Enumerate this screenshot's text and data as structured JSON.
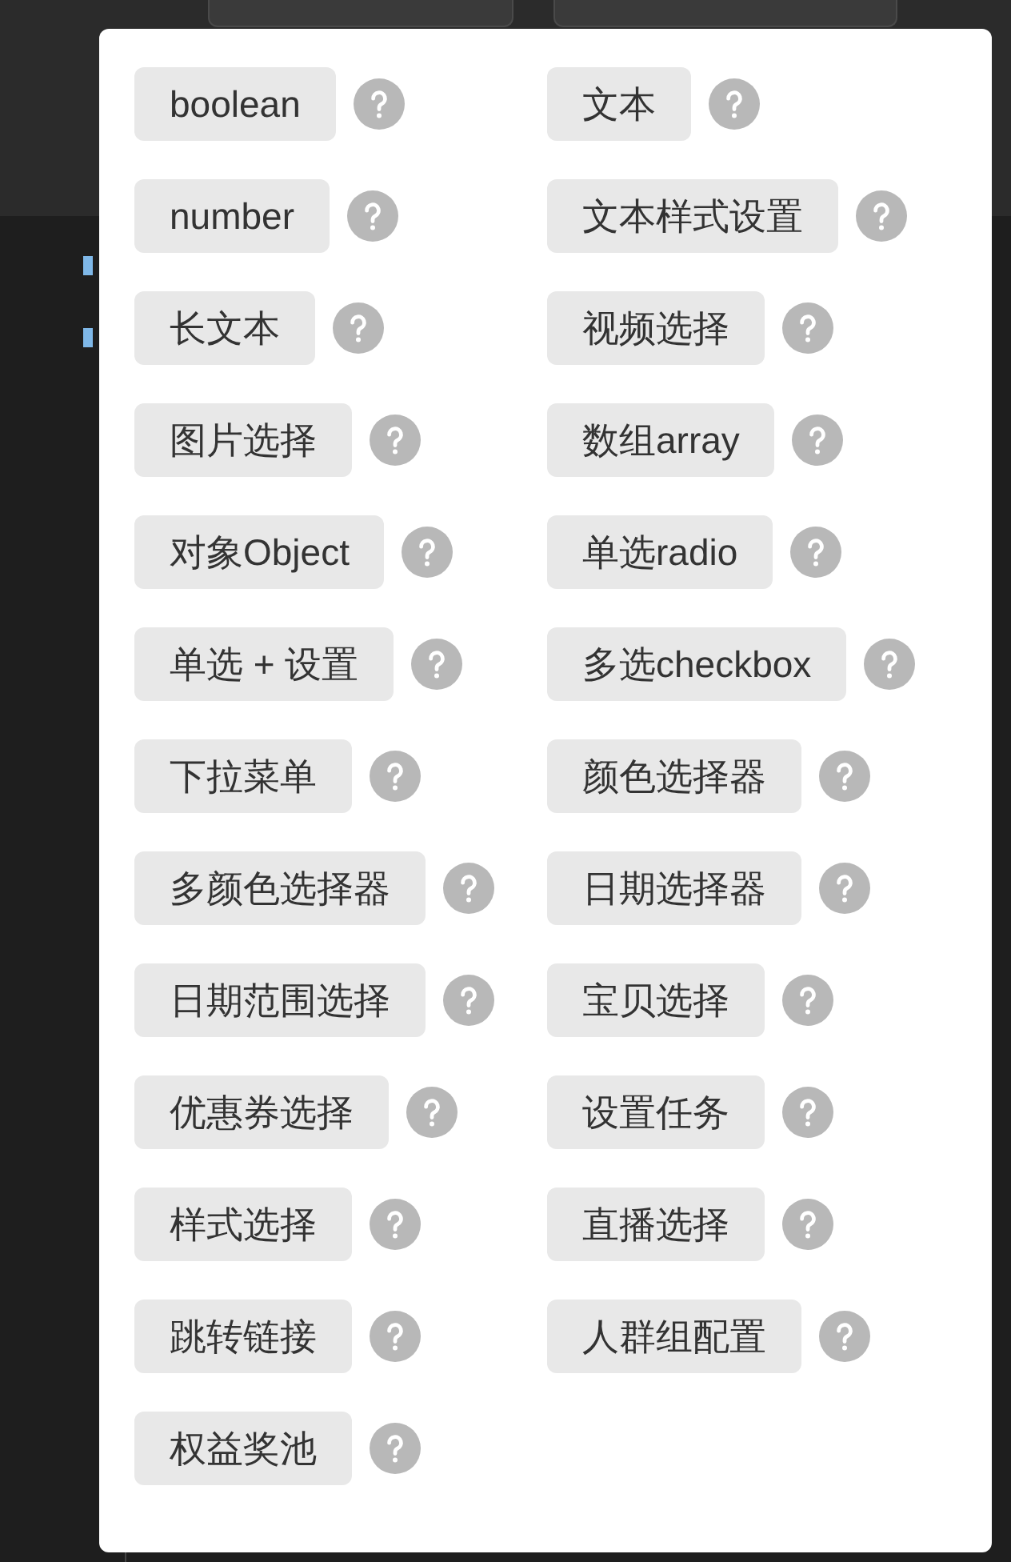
{
  "popover": {
    "items": [
      {
        "label": "boolean"
      },
      {
        "label": "文本"
      },
      {
        "label": "number"
      },
      {
        "label": "文本样式设置"
      },
      {
        "label": "长文本"
      },
      {
        "label": "视频选择"
      },
      {
        "label": "图片选择"
      },
      {
        "label": "数组array"
      },
      {
        "label": "对象Object"
      },
      {
        "label": "单选radio"
      },
      {
        "label": "单选 + 设置"
      },
      {
        "label": "多选checkbox"
      },
      {
        "label": "下拉菜单"
      },
      {
        "label": "颜色选择器"
      },
      {
        "label": "多颜色选择器"
      },
      {
        "label": "日期选择器"
      },
      {
        "label": "日期范围选择"
      },
      {
        "label": "宝贝选择"
      },
      {
        "label": "优惠券选择"
      },
      {
        "label": "设置任务"
      },
      {
        "label": "样式选择"
      },
      {
        "label": "直播选择"
      },
      {
        "label": "跳转链接"
      },
      {
        "label": "人群组配置"
      },
      {
        "label": "权益奖池"
      }
    ]
  }
}
